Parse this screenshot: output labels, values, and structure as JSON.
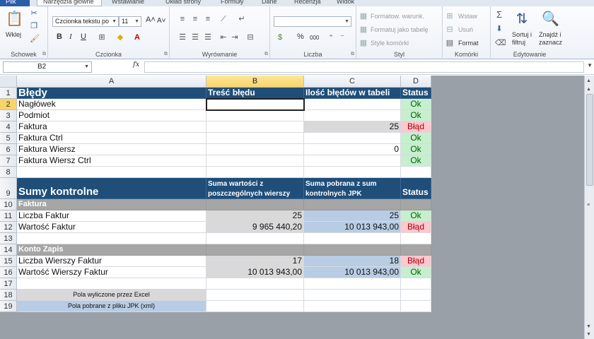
{
  "tabs": [
    "Plik",
    "Narzędzia główne",
    "Wstawianie",
    "Układ strony",
    "Formuły",
    "Dane",
    "Recenzja",
    "Widok"
  ],
  "ribbon": {
    "groups": {
      "clipboard": "Schowek",
      "font": "Czcionka",
      "alignment": "Wyrównanie",
      "number": "Liczba",
      "style": "Styl",
      "cells": "Komórki",
      "editing": "Edytowanie"
    },
    "paste_label": "Wklej",
    "font_name": "Czcionka tekstu po",
    "font_size": "11",
    "bold": "B",
    "italic": "I",
    "underline": "U",
    "percent": "%",
    "thousands": "000",
    "style_buttons": [
      "Formatow. warunk.",
      "Formatuj jako tabelę",
      "Style komórki"
    ],
    "cells_buttons": [
      "Wstaw",
      "Usuń",
      "Format"
    ],
    "sort_label_1": "Sortuj i",
    "sort_label_2": "filtruj",
    "find_label_1": "Znajdź i",
    "find_label_2": "zaznacz"
  },
  "formula_bar": {
    "name_box": "B2",
    "fx": "fx",
    "formula": ""
  },
  "columns": [
    "A",
    "B",
    "C",
    "D"
  ],
  "rows": [
    {
      "n": "1",
      "cells": [
        {
          "t": "Błędy",
          "s": "hdr big"
        },
        {
          "t": "Treść błędu",
          "s": "hdr"
        },
        {
          "t": "Ilość błędów w tabeli",
          "s": "hdr"
        },
        {
          "t": "Status",
          "s": "hdr"
        }
      ]
    },
    {
      "n": "2",
      "cells": [
        {
          "t": "Nagłówek",
          "s": ""
        },
        {
          "t": "",
          "s": ""
        },
        {
          "t": "",
          "s": ""
        },
        {
          "t": "Ok",
          "s": "ok ctr"
        }
      ]
    },
    {
      "n": "3",
      "cells": [
        {
          "t": "Podmiot",
          "s": ""
        },
        {
          "t": "",
          "s": ""
        },
        {
          "t": "",
          "s": ""
        },
        {
          "t": "Ok",
          "s": "ok ctr"
        }
      ]
    },
    {
      "n": "4",
      "cells": [
        {
          "t": "Faktura",
          "s": ""
        },
        {
          "t": "",
          "s": ""
        },
        {
          "t": "25",
          "s": "grey num"
        },
        {
          "t": "Błąd",
          "s": "bad ctr"
        }
      ]
    },
    {
      "n": "5",
      "cells": [
        {
          "t": "Faktura Ctrl",
          "s": ""
        },
        {
          "t": "",
          "s": ""
        },
        {
          "t": "",
          "s": ""
        },
        {
          "t": "Ok",
          "s": "ok ctr"
        }
      ]
    },
    {
      "n": "6",
      "cells": [
        {
          "t": "Faktura Wiersz",
          "s": ""
        },
        {
          "t": "",
          "s": ""
        },
        {
          "t": "0",
          "s": "num"
        },
        {
          "t": "Ok",
          "s": "ok ctr"
        }
      ]
    },
    {
      "n": "7",
      "cells": [
        {
          "t": "Faktura Wiersz Ctrl",
          "s": ""
        },
        {
          "t": "",
          "s": ""
        },
        {
          "t": "",
          "s": ""
        },
        {
          "t": "Ok",
          "s": "ok ctr"
        }
      ]
    },
    {
      "n": "8",
      "cells": [
        {
          "t": "",
          "s": ""
        },
        {
          "t": "",
          "s": ""
        },
        {
          "t": "",
          "s": ""
        },
        {
          "t": "",
          "s": ""
        }
      ]
    },
    {
      "n": "9",
      "cells": [
        {
          "t": "Sumy kontrolne",
          "s": "hdr big"
        },
        {
          "t": "Suma wartości z poszczególnych wierszy",
          "s": "hdr sub"
        },
        {
          "t": "Suma pobrana z sum kontrolnych JPK",
          "s": "hdr sub"
        },
        {
          "t": "Status",
          "s": "hdr"
        }
      ]
    },
    {
      "n": "10",
      "cells": [
        {
          "t": "Faktura",
          "s": "sect"
        },
        {
          "t": "",
          "s": "sect"
        },
        {
          "t": "",
          "s": "sect"
        },
        {
          "t": "",
          "s": "sect"
        }
      ]
    },
    {
      "n": "11",
      "cells": [
        {
          "t": "Liczba Faktur",
          "s": ""
        },
        {
          "t": "25",
          "s": "grey num"
        },
        {
          "t": "25",
          "s": "blue num"
        },
        {
          "t": "Ok",
          "s": "ok ctr"
        }
      ]
    },
    {
      "n": "12",
      "cells": [
        {
          "t": "Wartość Faktur",
          "s": ""
        },
        {
          "t": "9 965 440,20",
          "s": "grey num"
        },
        {
          "t": "10 013 943,00",
          "s": "blue num"
        },
        {
          "t": "Błąd",
          "s": "bad ctr"
        }
      ]
    },
    {
      "n": "13",
      "cells": [
        {
          "t": "",
          "s": ""
        },
        {
          "t": "",
          "s": ""
        },
        {
          "t": "",
          "s": ""
        },
        {
          "t": "",
          "s": ""
        }
      ]
    },
    {
      "n": "14",
      "cells": [
        {
          "t": "Konto Zapis",
          "s": "sect"
        },
        {
          "t": "",
          "s": "sect"
        },
        {
          "t": "",
          "s": "sect"
        },
        {
          "t": "",
          "s": "sect"
        }
      ]
    },
    {
      "n": "15",
      "cells": [
        {
          "t": "Liczba Wierszy Faktur",
          "s": ""
        },
        {
          "t": "17",
          "s": "grey num"
        },
        {
          "t": "18",
          "s": "blue num"
        },
        {
          "t": "Błąd",
          "s": "bad ctr"
        }
      ]
    },
    {
      "n": "16",
      "cells": [
        {
          "t": "Wartość Wierszy Faktur",
          "s": ""
        },
        {
          "t": "10 013 943,00",
          "s": "grey num"
        },
        {
          "t": "10 013 943,00",
          "s": "blue num"
        },
        {
          "t": "Ok",
          "s": "ok ctr"
        }
      ]
    },
    {
      "n": "17",
      "cells": [
        {
          "t": "",
          "s": ""
        },
        {
          "t": "",
          "s": ""
        },
        {
          "t": "",
          "s": ""
        },
        {
          "t": "",
          "s": ""
        }
      ]
    },
    {
      "n": "18",
      "cells": [
        {
          "t": "Pola wyliczone przez Excel",
          "s": "grey legend"
        },
        {
          "t": "",
          "s": ""
        },
        {
          "t": "",
          "s": ""
        },
        {
          "t": "",
          "s": ""
        }
      ]
    },
    {
      "n": "19",
      "cells": [
        {
          "t": "Pola pobrane z pliku JPK (xml)",
          "s": "blue legend"
        },
        {
          "t": "",
          "s": ""
        },
        {
          "t": "",
          "s": ""
        },
        {
          "t": "",
          "s": ""
        }
      ]
    }
  ],
  "colors": {
    "header": "#1f4e79",
    "ok_fill": "#c6efce",
    "error_fill": "#ffc7ce",
    "computed_fill": "#d9d9d9",
    "imported_fill": "#b8cce4",
    "section_fill": "#a6a6a6"
  }
}
